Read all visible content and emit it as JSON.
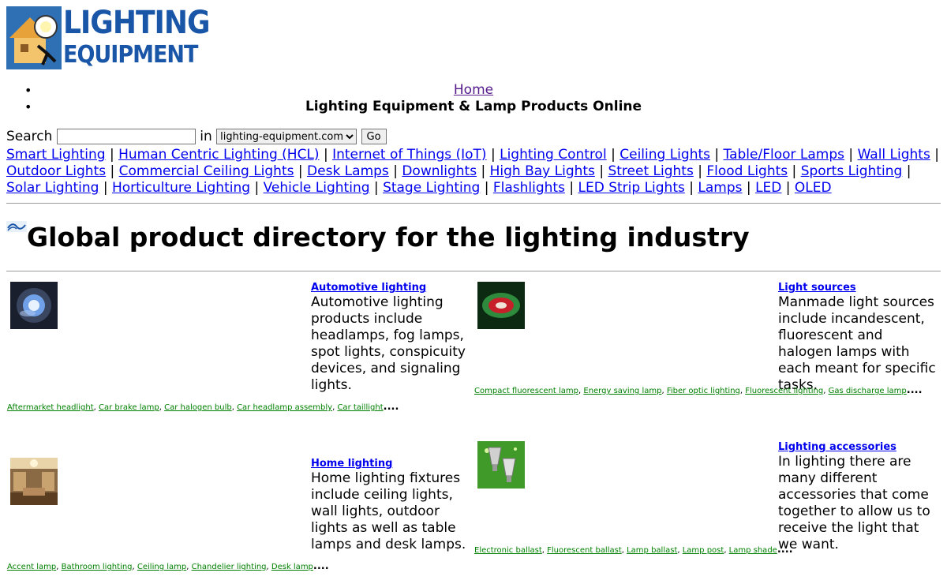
{
  "logo": {
    "line1": "LIGHTING",
    "line2": "EQUIPMENT"
  },
  "topnav": {
    "home": "Home",
    "tagline": "Lighting Equipment & Lamp Products Online"
  },
  "search": {
    "label": "Search",
    "in": "in",
    "input_value": "",
    "domain": "lighting-equipment.com",
    "go": "Go"
  },
  "categories": [
    "Smart Lighting",
    "Human Centric Lighting (HCL)",
    "Internet of Things (IoT)",
    "Lighting Control",
    "Ceiling Lights",
    "Table/Floor Lamps",
    "Wall Lights",
    "Outdoor Lights",
    "Commercial Ceiling Lights",
    "Desk Lamps",
    "Downlights",
    "High Bay Lights",
    "Street Lights",
    "Flood Lights",
    "Sports Lighting",
    "Solar Lighting",
    "Horticulture Lighting",
    "Vehicle Lighting",
    "Stage Lighting",
    "Flashlights",
    "LED Strip Lights",
    "Lamps",
    "LED",
    "OLED"
  ],
  "heading": "Global product directory for the lighting industry",
  "blocks": [
    {
      "title": "Automotive lighting",
      "description": "Automotive lighting products include headlamps, fog lamps, spot lights, conspicuity devices, and signaling lights.",
      "tags": [
        "Aftermarket headlight",
        "Car brake lamp",
        "Car halogen bulb",
        "Car headlamp assembly",
        "Car taillight"
      ],
      "more": "....",
      "thumb": "headlamp"
    },
    {
      "title": "Light sources",
      "description": "Manmade light sources include incandescent, fluorescent and halogen lamps with each meant for specific tasks.",
      "tags": [
        "Compact fluorescent lamp",
        "Energy saving lamp",
        "Fiber optic lighting",
        "Fluorescent lighting",
        "Gas discharge lamp"
      ],
      "more": "....",
      "thumb": "light-swirl"
    },
    {
      "title": "Home lighting",
      "description": "Home lighting fixtures include ceiling lights, wall lights, outdoor lights as well as table lamps and desk lamps.",
      "tags": [
        "Accent lamp",
        "Bathroom lighting",
        "Ceiling lamp",
        "Chandelier lighting",
        "Desk lamp"
      ],
      "more": "....",
      "thumb": "interior"
    },
    {
      "title": "Lighting accessories",
      "description": "In lighting there are many different accessories that come together to allow us to receive the light that we want.",
      "tags": [
        "Electronic ballast",
        "Fluorescent ballast",
        "Lamp ballast",
        "Lamp post",
        "Lamp shade"
      ],
      "more": "....",
      "thumb": "spotlights"
    }
  ]
}
